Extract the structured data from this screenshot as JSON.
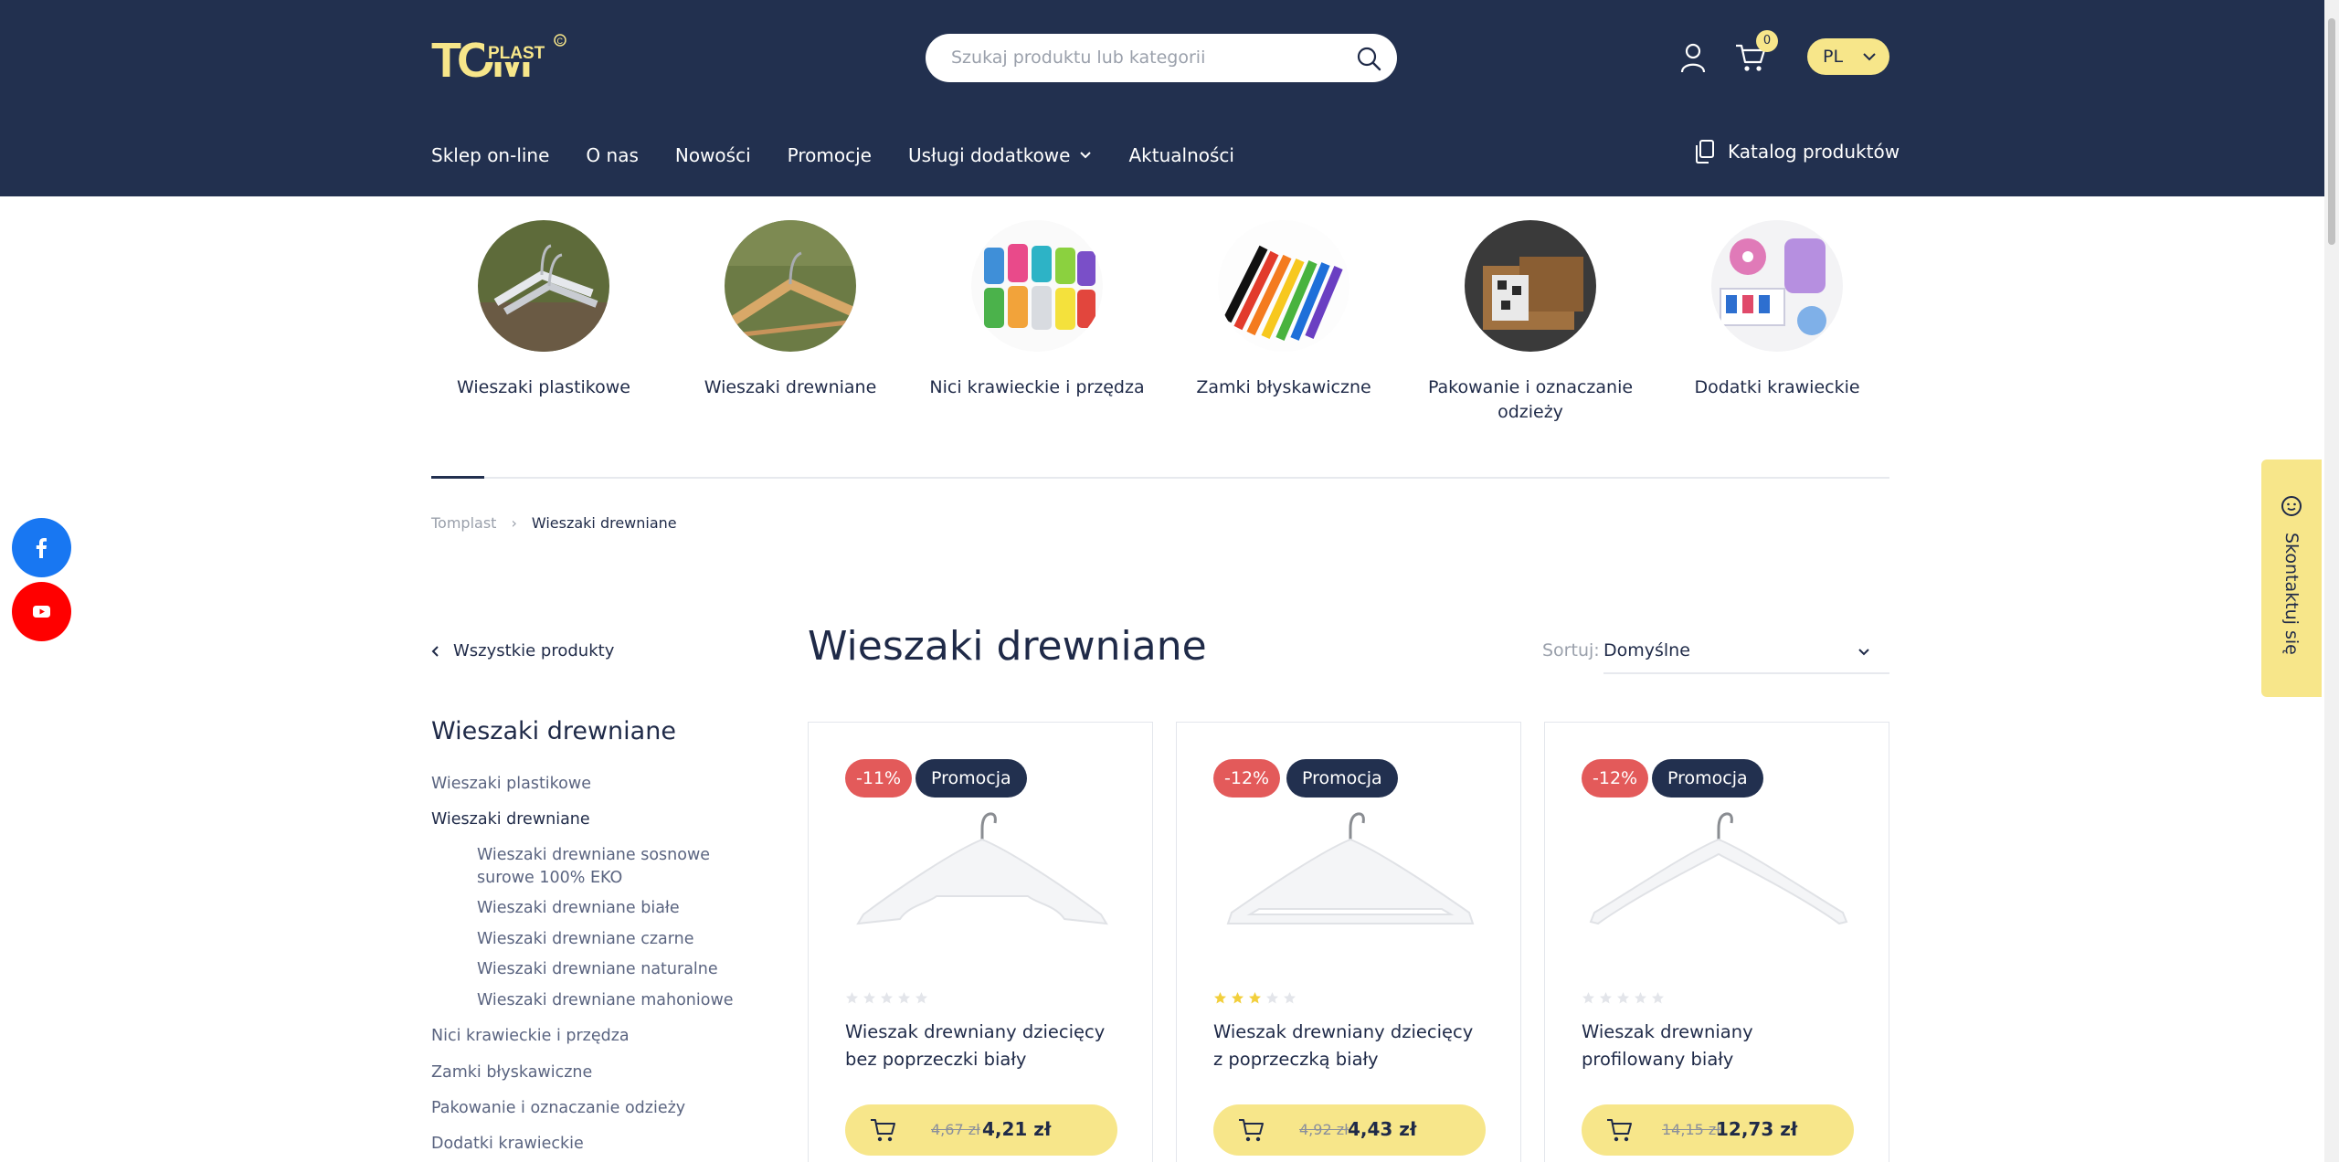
{
  "header": {
    "logo_text": "TOMPLAST",
    "search_placeholder": "Szukaj produktu lub kategorii",
    "cart_count": "0",
    "language": "PL"
  },
  "nav": {
    "items": [
      "Sklep on-line",
      "O nas",
      "Nowości",
      "Promocje",
      "Usługi dodatkowe",
      "Aktualności"
    ],
    "catalog_label": "Katalog produktów"
  },
  "categories": [
    {
      "label": "Wieszaki plastikowe"
    },
    {
      "label": "Wieszaki drewniane"
    },
    {
      "label": "Nici krawieckie i przędza"
    },
    {
      "label": "Zamki błyskawiczne"
    },
    {
      "label": "Pakowanie i oznaczanie odzieży"
    },
    {
      "label": "Dodatki krawieckie"
    }
  ],
  "breadcrumb": {
    "home": "Tomplast",
    "current": "Wieszaki drewniane"
  },
  "sidebar": {
    "back_label": "Wszystkie produkty",
    "title": "Wieszaki drewniane",
    "links": [
      "Wieszaki plastikowe",
      "Wieszaki drewniane",
      "Wieszaki drewniane sosnowe surowe 100% EKO",
      "Wieszaki drewniane białe",
      "Wieszaki drewniane czarne",
      "Wieszaki drewniane naturalne",
      "Wieszaki drewniane mahoniowe",
      "Nici krawieckie i przędza",
      "Zamki błyskawiczne",
      "Pakowanie i oznaczanie odzieży",
      "Dodatki krawieckie"
    ]
  },
  "main": {
    "title": "Wieszaki drewniane",
    "sort_label": "Sortuj:",
    "sort_value": "Domyślne"
  },
  "products": [
    {
      "discount": "-11%",
      "promo": "Promocja",
      "rating": 0,
      "name": "Wieszak drewniany dziecięcy bez poprzeczki biały",
      "old_price": "4,67 zł",
      "new_price": "4,21 zł"
    },
    {
      "discount": "-12%",
      "promo": "Promocja",
      "rating": 3,
      "name": "Wieszak drewniany dziecięcy z poprzeczką biały",
      "old_price": "4,92 zł",
      "new_price": "4,43 zł"
    },
    {
      "discount": "-12%",
      "promo": "Promocja",
      "rating": 0,
      "name": "Wieszak drewniany profilowany biały",
      "old_price": "14,15 zł",
      "new_price": "12,73 zł"
    }
  ],
  "contact_label": "Skontaktuj się",
  "colors": {
    "navy": "#22304f",
    "yellow": "#f7e68a",
    "red": "#e35a5a",
    "facebook": "#1877f2",
    "youtube": "#ff0000"
  }
}
